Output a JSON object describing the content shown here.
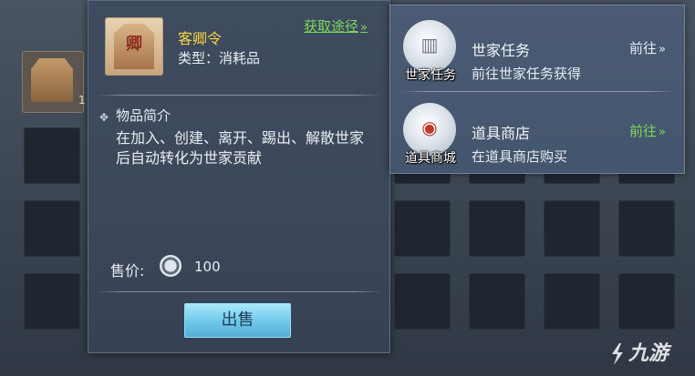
{
  "item": {
    "name": "客卿令",
    "icon_char": "卿",
    "type_text": "类型：消耗品",
    "source_link": "获取途径",
    "section_title": "物品简介",
    "description": "在加入、创建、离开、踢出、解散世家后自动转化为世家贡献",
    "price_label": "售价:",
    "price_value": "100",
    "sell_button": "出售"
  },
  "inventory_count": "1",
  "sources": [
    {
      "icon_label": "世家任务",
      "title": "世家任务",
      "desc": "前往世家任务获得",
      "go": "前往",
      "go_color": "#e5eaf0"
    },
    {
      "icon_label": "道具商城",
      "title": "道具商店",
      "desc": "在道具商店购买",
      "go": "前往",
      "go_color": "#7cd95b"
    }
  ],
  "watermark": "九游",
  "colors": {
    "name_yellow": "#f4d742",
    "link_green": "#7cd95b",
    "button_blue": "#6ec7e9"
  }
}
